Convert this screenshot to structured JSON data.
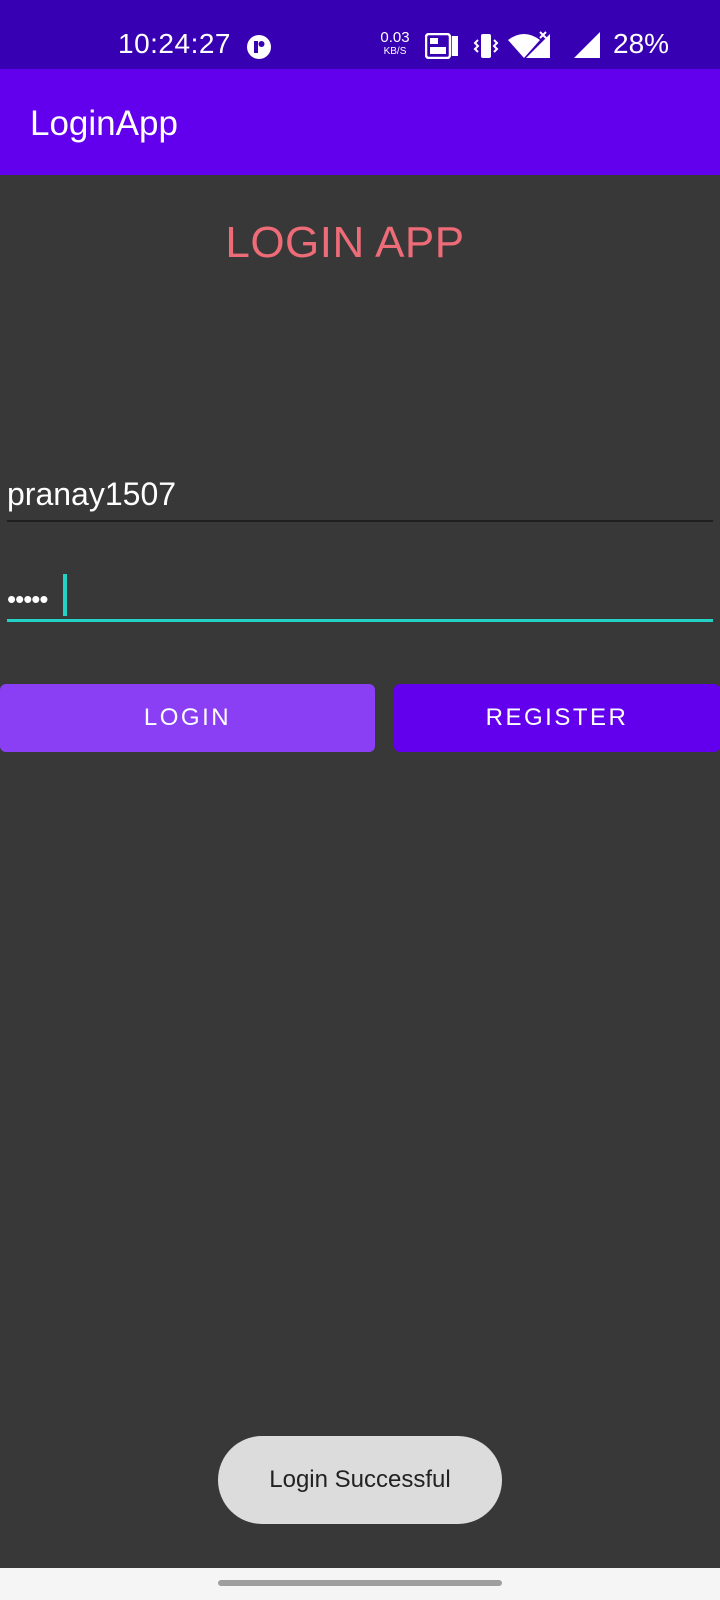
{
  "status_bar": {
    "time": "10:24:27",
    "net_speed_value": "0.03",
    "net_speed_unit": "KB/S",
    "battery": "28%",
    "icons": [
      "app-notification-icon",
      "volte-lte-icon",
      "vibrate-icon",
      "wifi-icon",
      "cellular-signal-icon"
    ]
  },
  "app_bar": {
    "title": "LoginApp"
  },
  "main": {
    "heading": "LOGIN APP",
    "username_value": "pranay1507",
    "password_mask": "•••••",
    "login_label": "LOGIN",
    "register_label": "REGISTER"
  },
  "toast": {
    "message": "Login Successful"
  },
  "colors": {
    "status_bar": "#3800b3",
    "app_bar": "#6200ee",
    "background": "#383838",
    "heading": "#ee6b78",
    "accent": "#22d3c5",
    "login_button": "#8a3ff5",
    "register_button": "#6200ee"
  }
}
